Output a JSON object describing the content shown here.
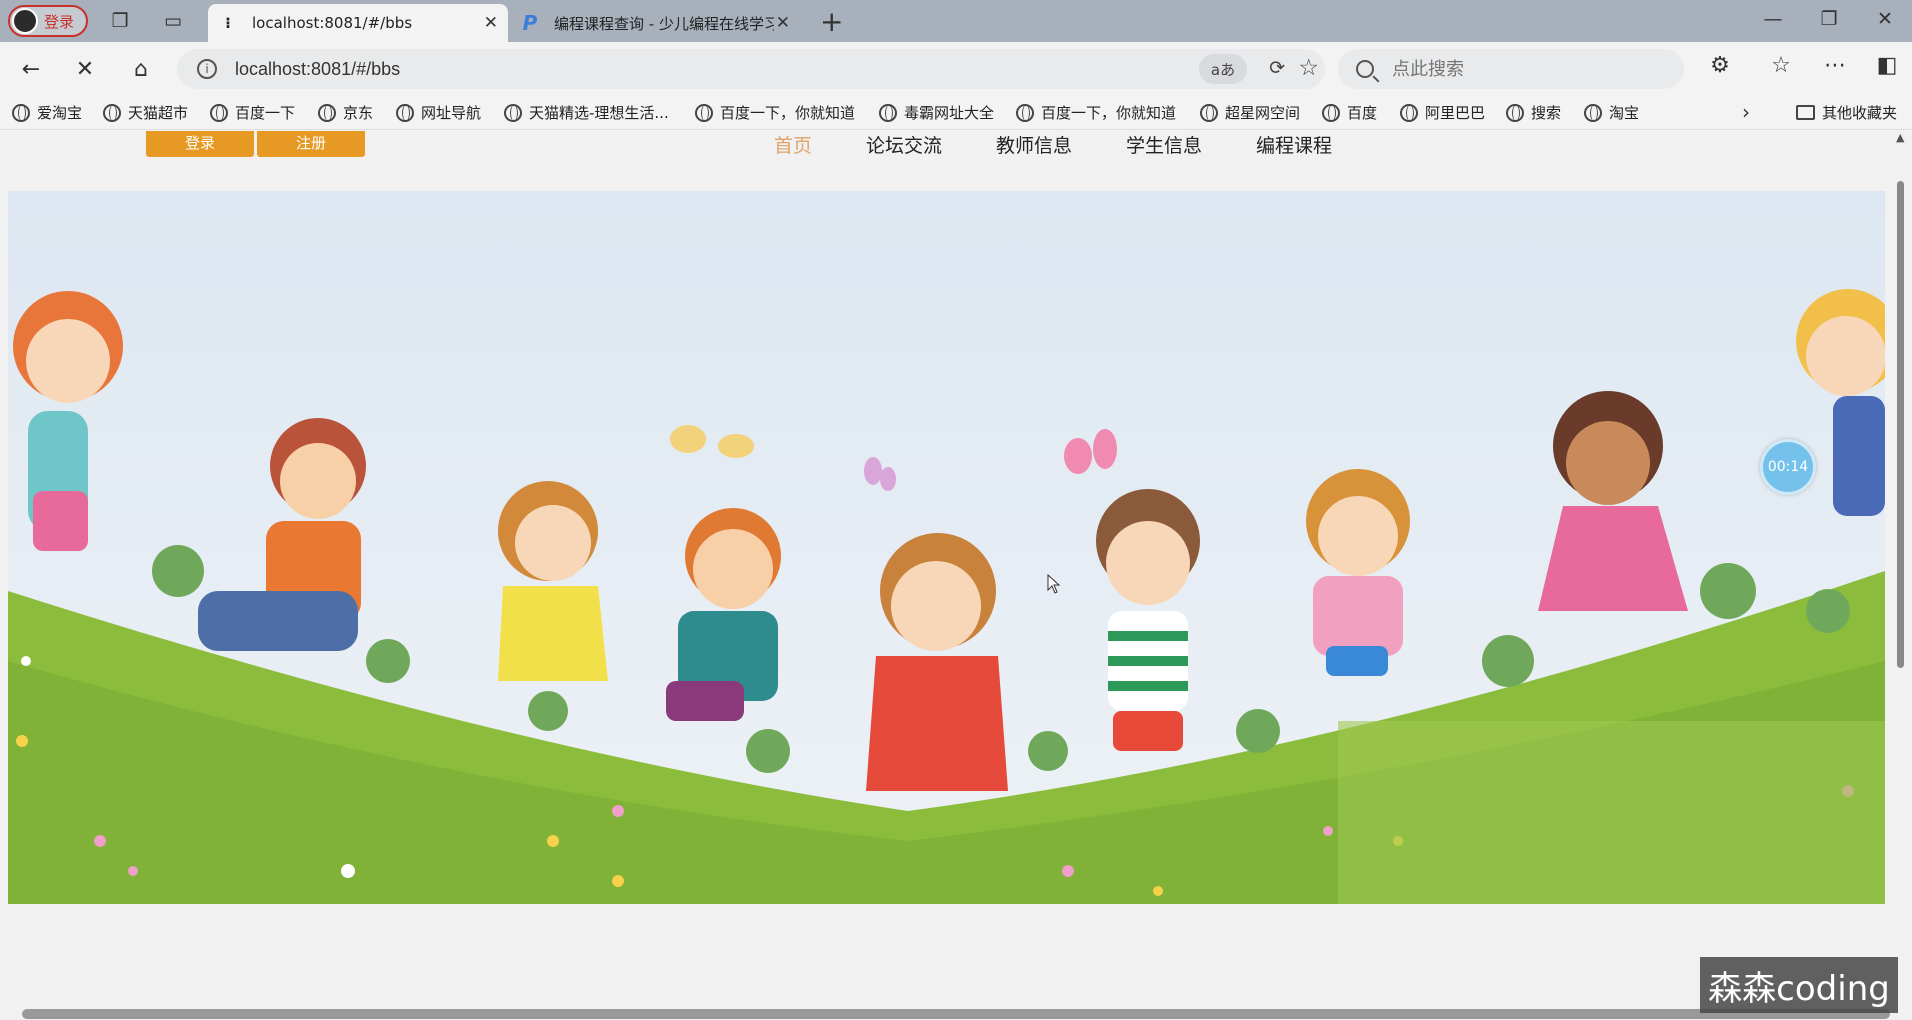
{
  "browser": {
    "profile_label": "登录",
    "tabs": [
      {
        "title": "localhost:8081/#/bbs",
        "active": true
      },
      {
        "title": "编程课程查询 - 少儿编程在线学习",
        "active": false
      }
    ],
    "url": "localhost:8081/#/bbs",
    "translate_label": "aあ",
    "search_placeholder": "点此搜索"
  },
  "bookmarks": [
    {
      "label": "爱淘宝"
    },
    {
      "label": "天猫超市"
    },
    {
      "label": "百度一下"
    },
    {
      "label": "京东"
    },
    {
      "label": "网址导航"
    },
    {
      "label": "天猫精选-理想生活..."
    },
    {
      "label": "百度一下，你就知道"
    },
    {
      "label": "毒霸网址大全"
    },
    {
      "label": "百度一下，你就知道"
    },
    {
      "label": "超星网空间"
    },
    {
      "label": "百度"
    },
    {
      "label": "阿里巴巴"
    },
    {
      "label": "搜索"
    },
    {
      "label": "淘宝"
    }
  ],
  "other_bookmarks": "其他收藏夹",
  "site": {
    "login_label": "登录",
    "register_label": "注册",
    "nav": [
      {
        "label": "首页",
        "active": true
      },
      {
        "label": "论坛交流",
        "active": false
      },
      {
        "label": "教师信息",
        "active": false
      },
      {
        "label": "学生信息",
        "active": false
      },
      {
        "label": "编程课程",
        "active": false
      }
    ]
  },
  "timer": "00:14",
  "watermark": "森森coding",
  "colors": {
    "accent_orange": "#e69a24",
    "nav_active": "#e0a36b",
    "timer_blue": "#74c2ec",
    "grass": "#8cbc3c",
    "sky": "#e3ecf4"
  }
}
